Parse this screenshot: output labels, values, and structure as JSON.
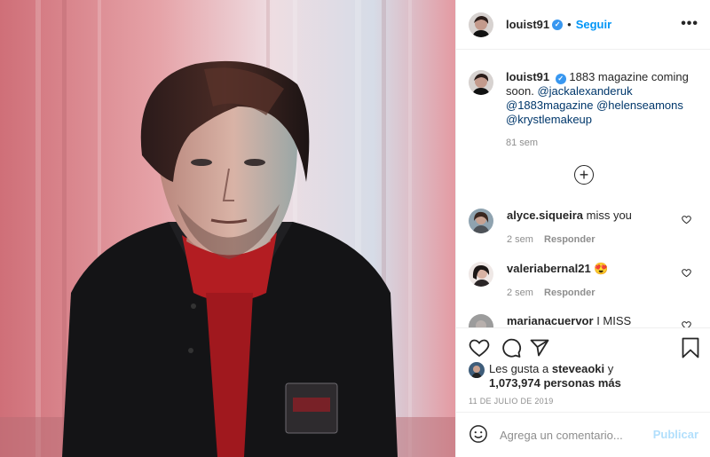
{
  "post": {
    "author": "louist91",
    "follow_label": "Seguir",
    "dot": "•",
    "more": "•••",
    "verified_glyph": "✓"
  },
  "caption": {
    "username": "louist91",
    "text": "1883 magazine coming soon.",
    "mentions": [
      "@jackalexanderuk",
      "@1883magazine",
      "@helenseamons",
      "@krystlemakeup"
    ],
    "time": "81 sem"
  },
  "load_more_glyph": "+",
  "comments": [
    {
      "username": "alyce.siqueira",
      "text": "miss you",
      "time": "2 sem",
      "reply_label": "Responder"
    },
    {
      "username": "valeriabernal21",
      "text": "😍",
      "time": "2 sem",
      "reply_label": "Responder"
    },
    {
      "username": "marianacuervor",
      "text": "I MISS",
      "time": "",
      "reply_label": ""
    }
  ],
  "likes": {
    "prefix": "Les gusta a",
    "user": "steveaoki",
    "connector": "y",
    "count": "1,073,974 personas más"
  },
  "date": "11 DE JULIO DE 2019",
  "add_comment": {
    "placeholder": "Agrega un comentario...",
    "publish_label": "Publicar"
  },
  "colors": {
    "link_blue": "#0095f6",
    "mention_blue": "#00376b",
    "muted": "#8e8e8e",
    "publish_disabled": "#b2dffc"
  },
  "icons": [
    "heart-icon",
    "comment-icon",
    "share-icon",
    "bookmark-icon",
    "emoji-icon",
    "plus-circle-icon",
    "verified-badge-icon",
    "more-options-icon"
  ]
}
